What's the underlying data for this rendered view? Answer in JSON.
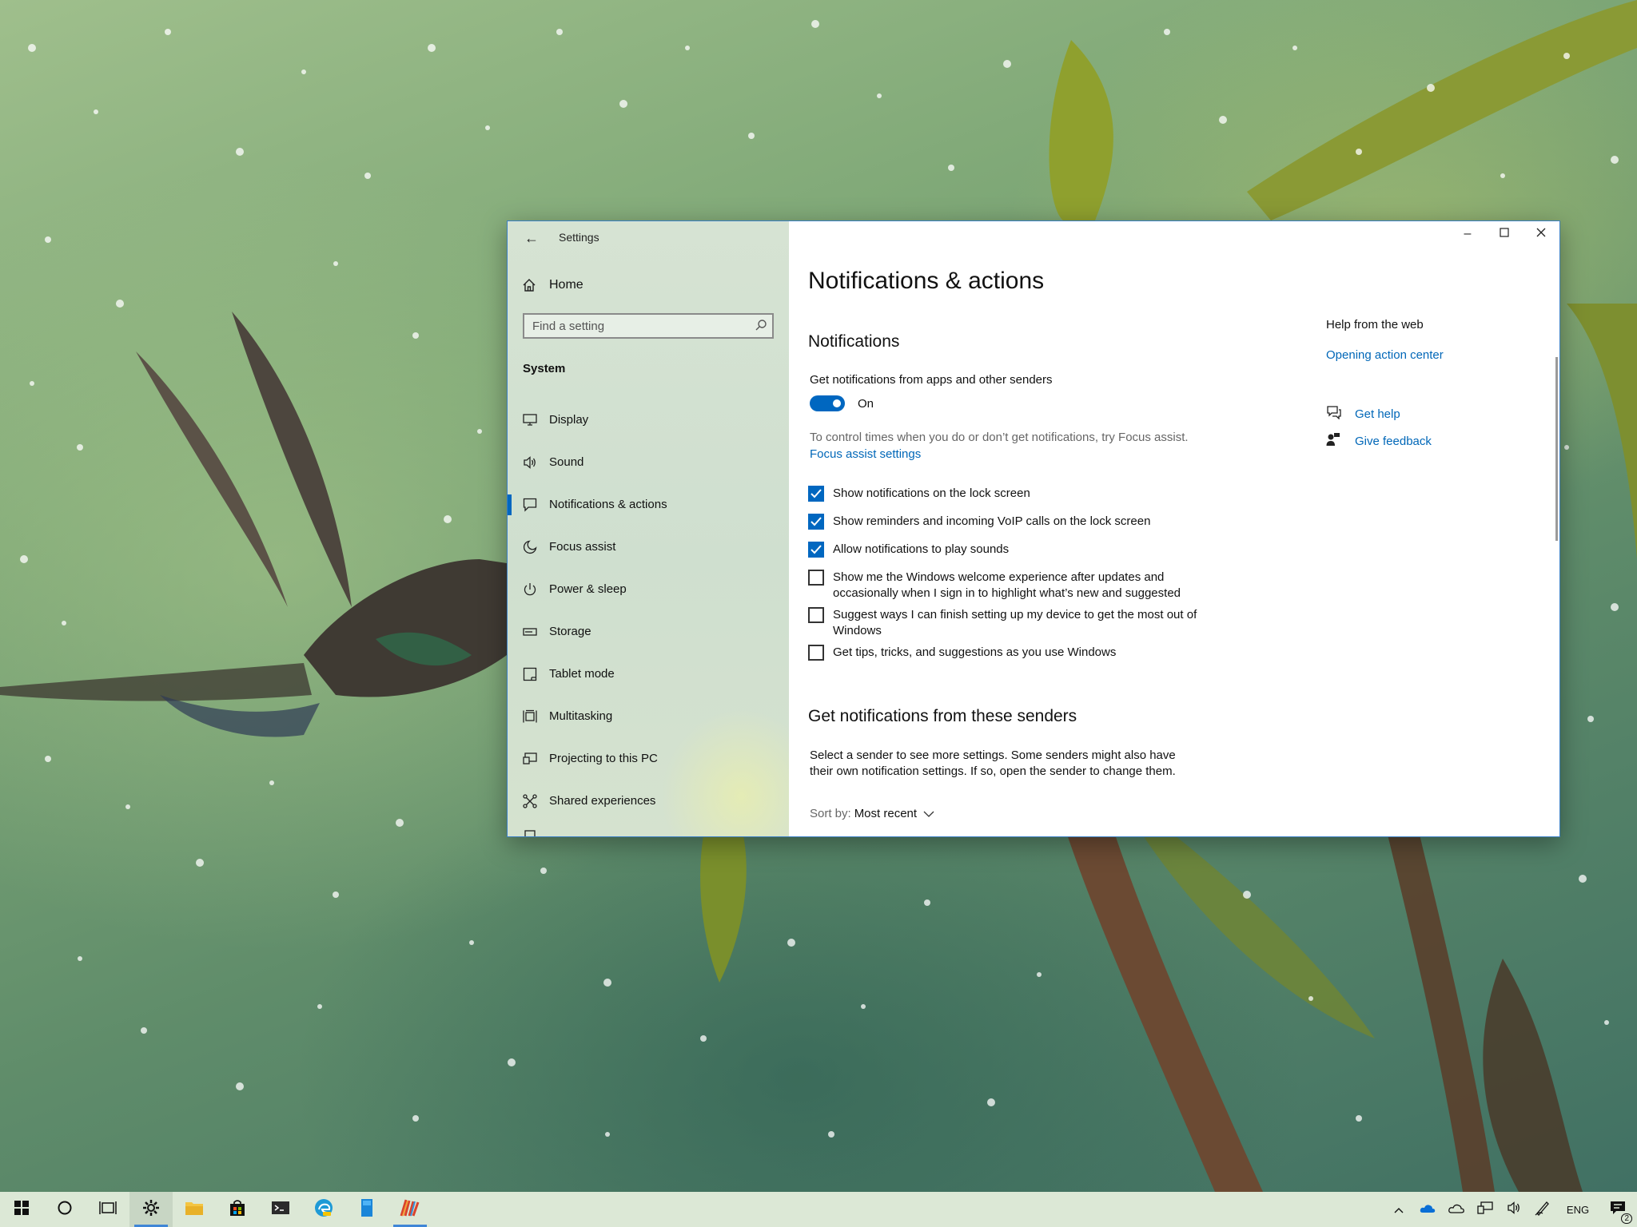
{
  "window": {
    "title": "Settings",
    "home_label": "Home",
    "search_placeholder": "Find a setting",
    "section": "System",
    "nav_items": [
      {
        "label": "Display",
        "icon": "display-icon"
      },
      {
        "label": "Sound",
        "icon": "speaker-icon"
      },
      {
        "label": "Notifications & actions",
        "icon": "notification-icon",
        "active": true
      },
      {
        "label": "Focus assist",
        "icon": "moon-icon"
      },
      {
        "label": "Power & sleep",
        "icon": "power-icon"
      },
      {
        "label": "Storage",
        "icon": "storage-icon"
      },
      {
        "label": "Tablet mode",
        "icon": "tablet-icon"
      },
      {
        "label": "Multitasking",
        "icon": "multitasking-icon"
      },
      {
        "label": "Projecting to this PC",
        "icon": "projector-icon"
      },
      {
        "label": "Shared experiences",
        "icon": "share-icon"
      }
    ]
  },
  "page": {
    "title": "Notifications & actions",
    "notifications_heading": "Notifications",
    "get_notifications_label": "Get notifications from apps and other senders",
    "toggle_state": "On",
    "focus_hint": "To control times when you do or don’t get notifications, try Focus assist.",
    "focus_link": "Focus assist settings",
    "checkboxes": [
      {
        "label": "Show notifications on the lock screen",
        "checked": true
      },
      {
        "label": "Show reminders and incoming VoIP calls on the lock screen",
        "checked": true
      },
      {
        "label": "Allow notifications to play sounds",
        "checked": true
      },
      {
        "label": "Show me the Windows welcome experience after updates and occasionally when I sign in to highlight what’s new and suggested",
        "checked": false
      },
      {
        "label": "Suggest ways I can finish setting up my device to get the most out of Windows",
        "checked": false
      },
      {
        "label": "Get tips, tricks, and suggestions as you use Windows",
        "checked": false
      }
    ],
    "senders_heading": "Get notifications from these senders",
    "senders_desc": "Select a sender to see more settings. Some senders might also have their own notification settings. If so, open the sender to change them.",
    "sort_label": "Sort by:",
    "sort_value": "Most recent"
  },
  "help": {
    "heading": "Help from the web",
    "link": "Opening action center",
    "get_help": "Get help",
    "give_feedback": "Give feedback"
  },
  "taskbar": {
    "language": "ENG",
    "notification_count": "2"
  },
  "colors": {
    "accent": "#0067c0",
    "link": "#0067b8",
    "nav_bg": "#d2e1d1"
  }
}
